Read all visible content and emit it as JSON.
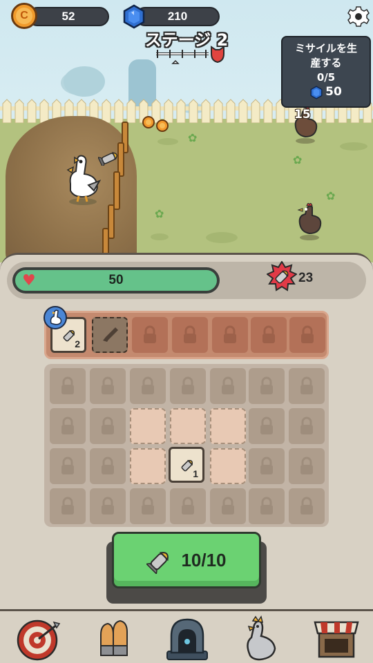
{
  "currency": {
    "coins": "52",
    "gems": "210"
  },
  "stage": {
    "title": "ステージ 2"
  },
  "mission": {
    "line1": "ミサイルを生",
    "line2": "産する",
    "progress": "0/5",
    "reward": "50"
  },
  "floating": {
    "damage": "15"
  },
  "player": {
    "hp": "50",
    "hp_fraction": 1.0,
    "ammo": "23"
  },
  "equipment": {
    "slot1_count": "2"
  },
  "inventory": {
    "item_count": "1"
  },
  "produce": {
    "label": "10/10"
  },
  "icons": {
    "coin": "coin-icon",
    "gem": "gem-icon",
    "settings": "gear-icon",
    "heart": "heart-icon",
    "missile": "missile-icon",
    "nav": [
      "target-icon",
      "bullets-icon",
      "forge-icon",
      "chicken-icon",
      "shop-icon"
    ]
  },
  "colors": {
    "hp_fill": "#65c28a",
    "produce_button": "#6bd272",
    "locked_equip": "#b37158"
  }
}
